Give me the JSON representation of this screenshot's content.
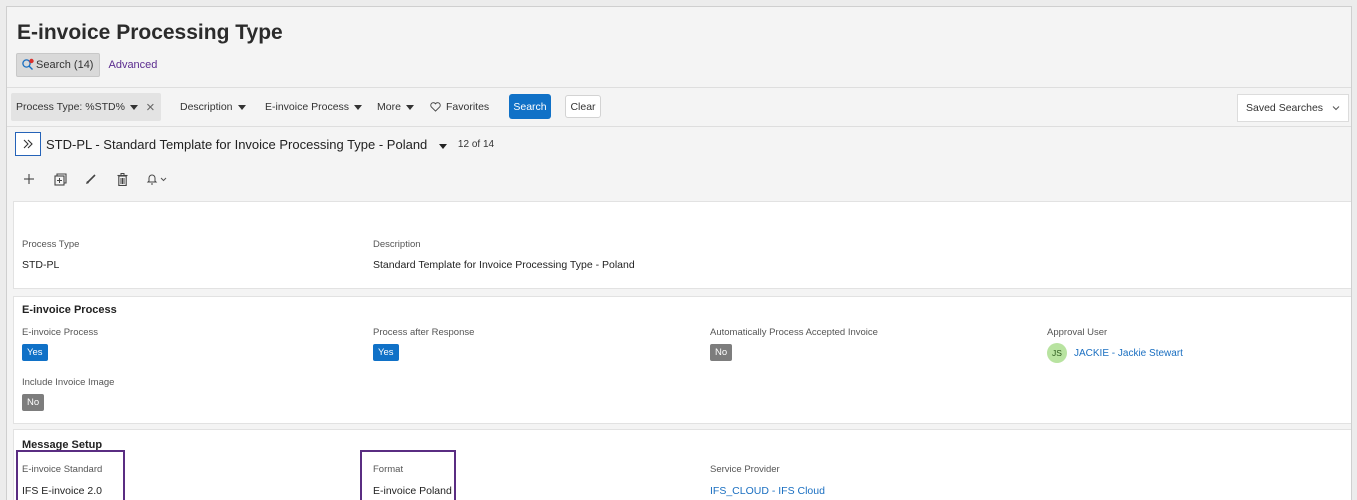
{
  "page": {
    "title": "E-invoice Processing Type"
  },
  "search_tabs": {
    "search_label": "Search (14)",
    "advanced_label": "Advanced"
  },
  "filter_bar": {
    "active_filter": "Process Type: %STD%",
    "filters": [
      "Description",
      "E-invoice Process",
      "More"
    ],
    "favorites_label": "Favorites",
    "search_button": "Search",
    "clear_button": "Clear",
    "saved_searches": "Saved Searches"
  },
  "record": {
    "title": "STD-PL - Standard Template for Invoice Processing Type - Poland",
    "position": "12 of 14"
  },
  "toolbar": {
    "icons": [
      "plus-icon",
      "copy-icon",
      "edit-icon",
      "delete-icon",
      "bell-icon"
    ]
  },
  "main_card": {
    "process_type_label": "Process Type",
    "process_type_value": "STD-PL",
    "description_label": "Description",
    "description_value": "Standard Template for Invoice Processing Type - Poland"
  },
  "einvoice_card": {
    "heading": "E-invoice Process",
    "einvoice_process_label": "E-invoice Process",
    "einvoice_process_value": "Yes",
    "process_after_response_label": "Process after Response",
    "process_after_response_value": "Yes",
    "auto_process_label": "Automatically Process Accepted Invoice",
    "auto_process_value": "No",
    "approval_user_label": "Approval User",
    "approval_user_initials": "JS",
    "approval_user_value": "JACKIE - Jackie Stewart",
    "include_image_label": "Include Invoice Image",
    "include_image_value": "No"
  },
  "message_card": {
    "heading": "Message Setup",
    "standard_label": "E-invoice Standard",
    "standard_value": "IFS E-invoice 2.0",
    "format_label": "Format",
    "format_value": "E-invoice Poland",
    "provider_label": "Service Provider",
    "provider_value": "IFS_CLOUD - IFS Cloud"
  },
  "colors": {
    "primary": "#1071c7",
    "highlight": "#5a2d82",
    "badge_no": "#7d7d7d",
    "link": "#1a6fc1"
  }
}
